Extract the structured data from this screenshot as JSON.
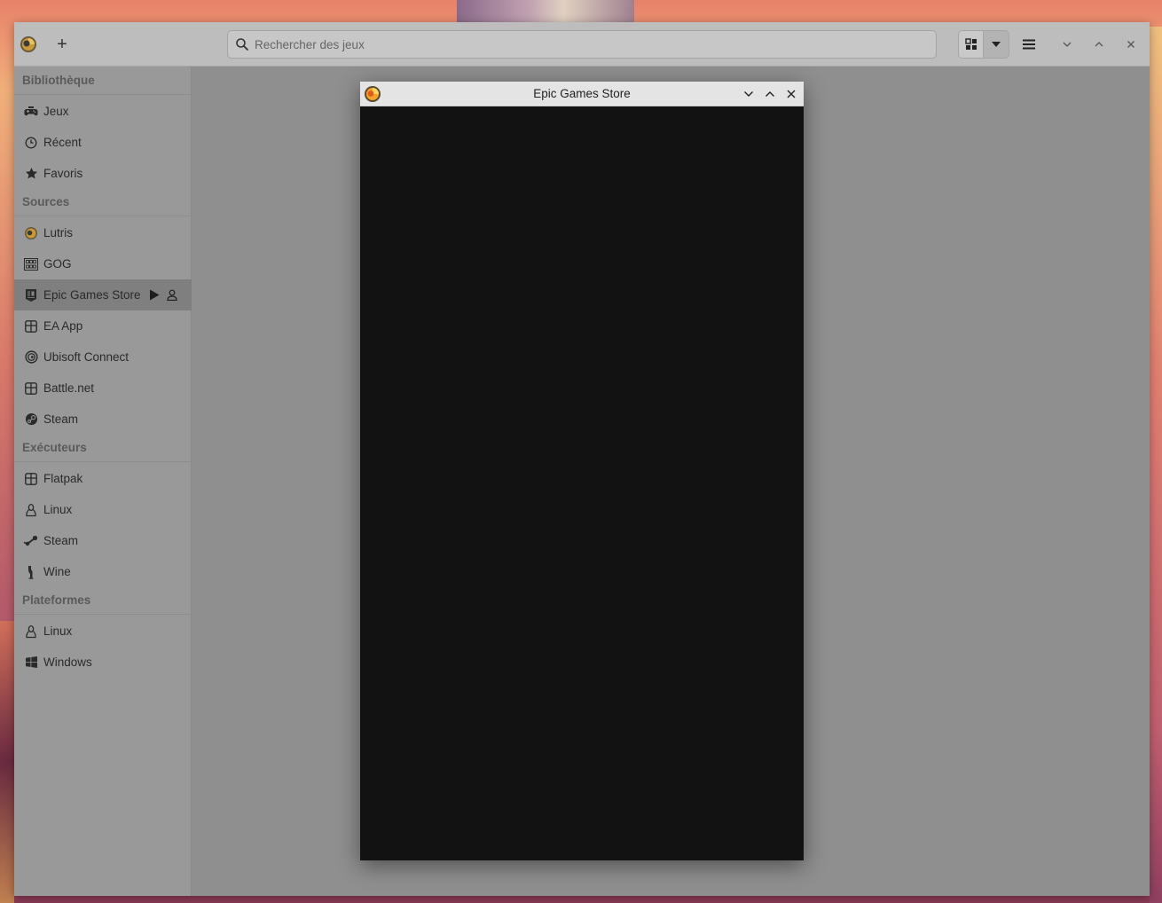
{
  "header": {
    "add_label": "+",
    "search_placeholder": "Rechercher des jeux"
  },
  "sidebar": {
    "sections": [
      {
        "title": "Bibliothèque",
        "items": [
          {
            "label": "Jeux",
            "icon": "gamepad-icon"
          },
          {
            "label": "Récent",
            "icon": "clock-icon"
          },
          {
            "label": "Favoris",
            "icon": "star-icon"
          }
        ]
      },
      {
        "title": "Sources",
        "items": [
          {
            "label": "Lutris",
            "icon": "lutris-icon"
          },
          {
            "label": "GOG",
            "icon": "gog-icon"
          },
          {
            "label": "Epic Games Store",
            "icon": "epic-icon",
            "selected": true
          },
          {
            "label": "EA App",
            "icon": "package-icon"
          },
          {
            "label": "Ubisoft Connect",
            "icon": "ubisoft-icon"
          },
          {
            "label": "Battle.net",
            "icon": "package-icon"
          },
          {
            "label": "Steam",
            "icon": "steam-icon"
          }
        ]
      },
      {
        "title": "Exécuteurs",
        "items": [
          {
            "label": "Flatpak",
            "icon": "package-icon"
          },
          {
            "label": "Linux",
            "icon": "tux-icon"
          },
          {
            "label": "Steam",
            "icon": "steam-runner-icon"
          },
          {
            "label": "Wine",
            "icon": "wine-icon"
          }
        ]
      },
      {
        "title": "Plateformes",
        "items": [
          {
            "label": "Linux",
            "icon": "tux-icon"
          },
          {
            "label": "Windows",
            "icon": "windows-icon"
          }
        ]
      }
    ]
  },
  "dialog": {
    "title": "Epic Games Store"
  }
}
